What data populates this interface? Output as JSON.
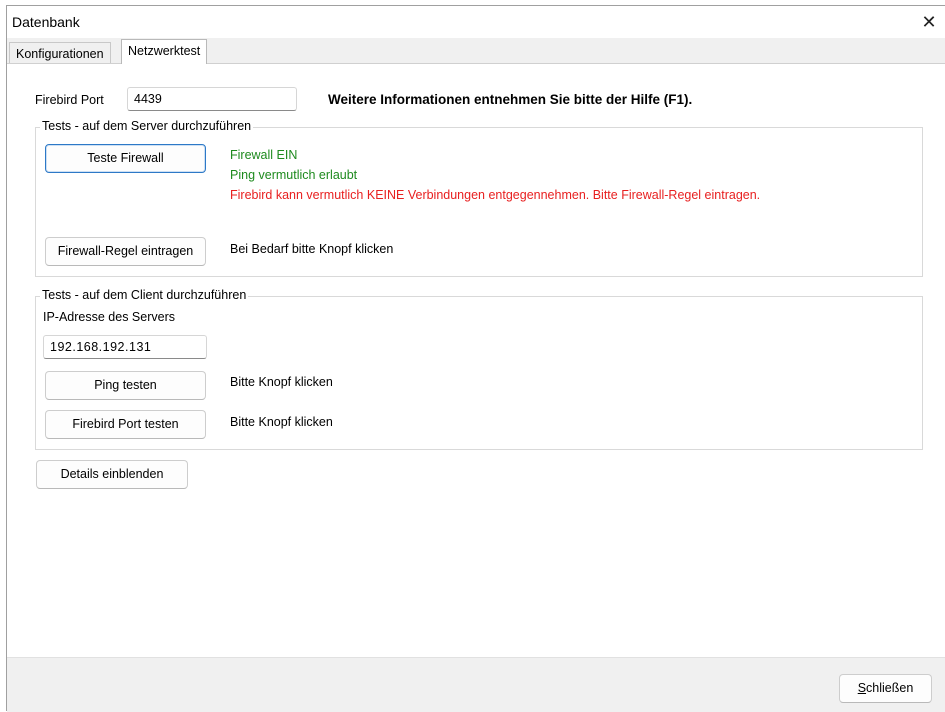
{
  "window": {
    "title": "Datenbank",
    "close_glyph": "✕"
  },
  "tabs": [
    {
      "label": "Konfigurationen",
      "active": false
    },
    {
      "label": "Netzwerktest",
      "active": true
    }
  ],
  "port": {
    "label": "Firebird Port",
    "value": "4439",
    "hint": "Weitere Informationen entnehmen Sie bitte der Hilfe (F1)."
  },
  "server_group": {
    "title": "Tests - auf dem Server durchzuführen",
    "test_firewall_button": "Teste Firewall",
    "status": [
      {
        "text": "Firewall EIN",
        "color": "#1e8a1e"
      },
      {
        "text": "Ping vermutlich erlaubt",
        "color": "#1e8a1e"
      },
      {
        "text": "Firebird kann vermutlich KEINE Verbindungen entgegennehmen. Bitte Firewall-Regel eintragen.",
        "color": "#e82020"
      }
    ],
    "add_rule_button": "Firewall-Regel eintragen",
    "add_rule_hint": "Bei Bedarf bitte Knopf klicken"
  },
  "client_group": {
    "title": "Tests - auf dem Client durchzuführen",
    "ip_label": "IP-Adresse des Servers",
    "ip_value": "192.168.192.131",
    "ping_button": "Ping testen",
    "ping_hint": "Bitte Knopf klicken",
    "port_button": "Firebird Port testen",
    "port_hint": "Bitte Knopf klicken"
  },
  "details_button": "Details einblenden",
  "footer": {
    "close_button": "Schließen"
  }
}
